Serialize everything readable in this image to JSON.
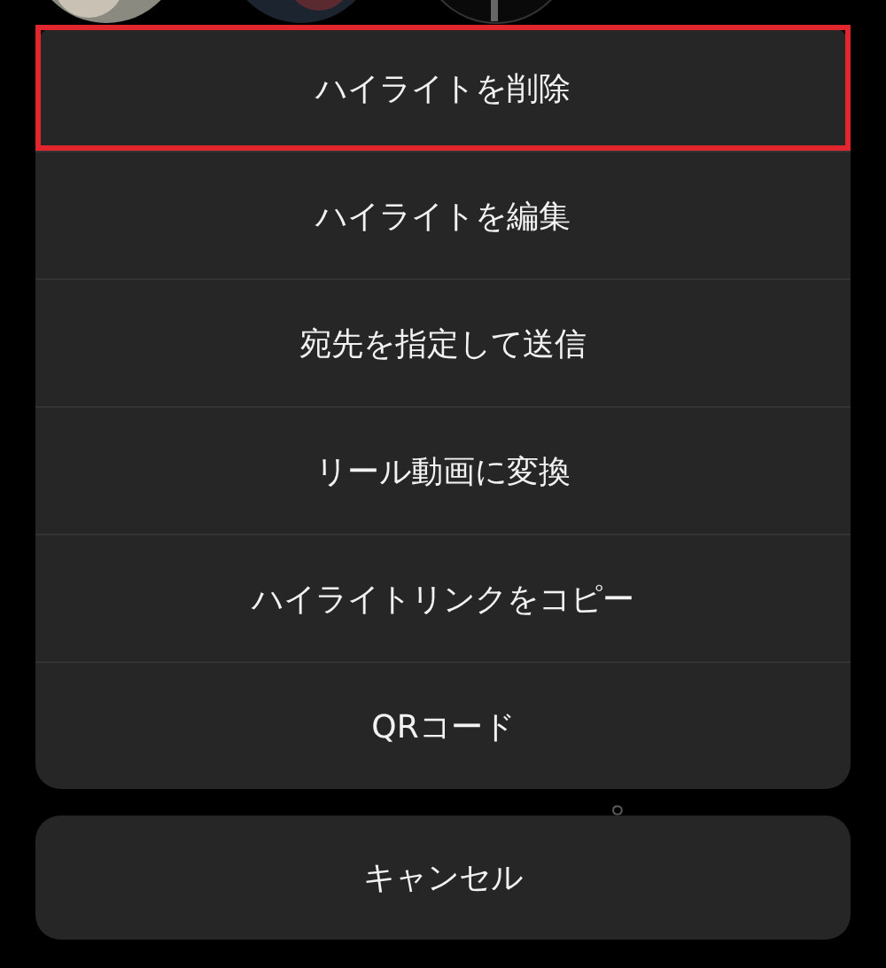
{
  "background_message": "。",
  "menu": [
    {
      "label": "ハイライトを削除",
      "highlighted": true
    },
    {
      "label": "ハイライトを編集",
      "highlighted": false
    },
    {
      "label": "宛先を指定して送信",
      "highlighted": false
    },
    {
      "label": "リール動画に変換",
      "highlighted": false
    },
    {
      "label": "ハイライトリンクをコピー",
      "highlighted": false
    },
    {
      "label": "QRコード",
      "highlighted": false
    }
  ],
  "cancel": "キャンセル"
}
